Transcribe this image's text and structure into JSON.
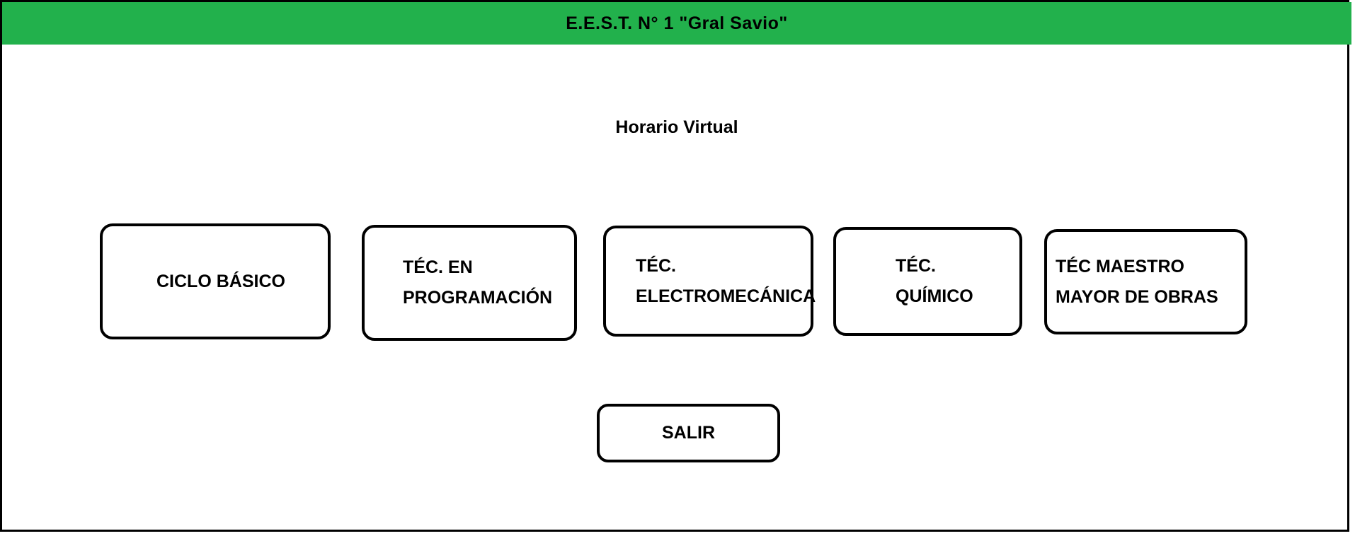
{
  "header": {
    "title": "E.E.S.T. N° 1 \"Gral Savio\"",
    "background_color": "#22b14c"
  },
  "main": {
    "subtitle": "Horario Virtual",
    "options": [
      {
        "line1": "CICLO BÁSICO"
      },
      {
        "line1": "TÉC. EN",
        "line2": "PROGRAMACIÓN"
      },
      {
        "line1": "TÉC.",
        "line2": "ELECTROMECÁNICA"
      },
      {
        "line1": "TÉC.",
        "line2": "QUÍMICO"
      },
      {
        "line1": "TÉC MAESTRO",
        "line2": "MAYOR DE OBRAS"
      }
    ],
    "exit_label": "SALIR"
  }
}
